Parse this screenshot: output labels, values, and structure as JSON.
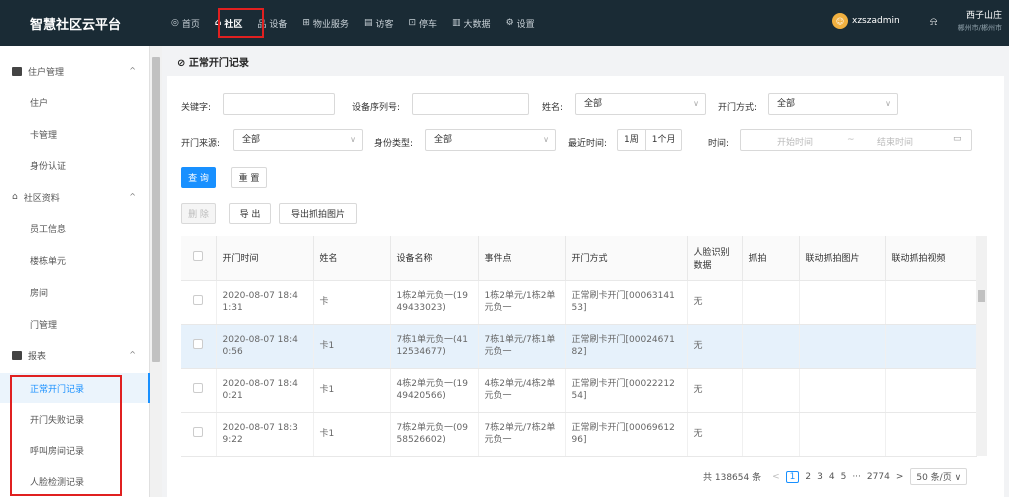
{
  "app": {
    "brand": "智慧社区云平台"
  },
  "nav": [
    {
      "icon": "◎",
      "label": "首页"
    },
    {
      "icon": "⌂",
      "label": "社区"
    },
    {
      "icon": "品",
      "label": "设备"
    },
    {
      "icon": "⊞",
      "label": "物业服务"
    },
    {
      "icon": "▤",
      "label": "访客"
    },
    {
      "icon": "⊡",
      "label": "停车"
    },
    {
      "icon": "▥",
      "label": "大数据"
    },
    {
      "icon": "⚙",
      "label": "设置"
    }
  ],
  "user": {
    "name": "xzszadmin",
    "site_name": "西子山庄",
    "site_city": "郴州市/郴州市"
  },
  "sidebar": {
    "groups": [
      {
        "label": "住户管理",
        "caret": "^"
      },
      {
        "label": "社区资料",
        "caret": "^"
      },
      {
        "label": "报表",
        "caret": "^"
      }
    ],
    "items": [
      "住户",
      "卡管理",
      "身份认证",
      "员工信息",
      "楼栋单元",
      "房间",
      "门管理",
      "正常开门记录",
      "开门失败记录",
      "呼叫房间记录",
      "人脸检测记录"
    ]
  },
  "page": {
    "title": "正常开门记录"
  },
  "filters": {
    "keyword_label": "关键字:",
    "serial_label": "设备序列号:",
    "name_label": "姓名:",
    "name_value": "全部",
    "open_method_label": "开门方式:",
    "open_method_value": "全部",
    "source_label": "开门来源:",
    "source_value": "全部",
    "identity_label": "身份类型:",
    "identity_value": "全部",
    "recent_label": "最近时间:",
    "recent_options": [
      "1周",
      "1个月"
    ],
    "time_label": "时间:",
    "start_placeholder": "开始时间",
    "range_sep": "~",
    "end_placeholder": "结束时间",
    "search_btn": "查 询",
    "reset_btn": "重 置"
  },
  "toolbar": {
    "delete": "删 除",
    "export": "导 出",
    "export_photos": "导出抓拍图片"
  },
  "table": {
    "columns": [
      "开门时间",
      "姓名",
      "设备名称",
      "事件点",
      "开门方式",
      "人脸识别数据",
      "抓拍",
      "联动抓拍图片",
      "联动抓拍视频"
    ],
    "rows": [
      {
        "time": "2020-08-07 18:41:31",
        "name": "卡",
        "device": "1栋2单元负一(1949433023)",
        "event": "1栋2单元/1栋2单元负一",
        "method": "正常刷卡开门[0006314153]",
        "face": "无",
        "selected": false
      },
      {
        "time": "2020-08-07 18:40:56",
        "name": "卡1",
        "device": "7栋1单元负一(4112534677)",
        "event": "7栋1单元/7栋1单元负一",
        "method": "正常刷卡开门[0002467182]",
        "face": "无",
        "selected": true
      },
      {
        "time": "2020-08-07 18:40:21",
        "name": "卡1",
        "device": "4栋2单元负一(1949420566)",
        "event": "4栋2单元/4栋2单元负一",
        "method": "正常刷卡开门[0002221254]",
        "face": "无",
        "selected": false
      },
      {
        "time": "2020-08-07 18:39:22",
        "name": "卡1",
        "device": "7栋2单元负一(0958526602)",
        "event": "7栋2单元/7栋2单元负一",
        "method": "正常刷卡开门[0006961296]",
        "face": "无",
        "selected": false
      }
    ]
  },
  "pagination": {
    "total": "共 138654 条",
    "prev": "<",
    "pages": [
      "1",
      "2",
      "3",
      "4",
      "5"
    ],
    "ellipsis": "···",
    "last": "2774",
    "next": ">",
    "page_size": "50 条/页 ∨"
  }
}
